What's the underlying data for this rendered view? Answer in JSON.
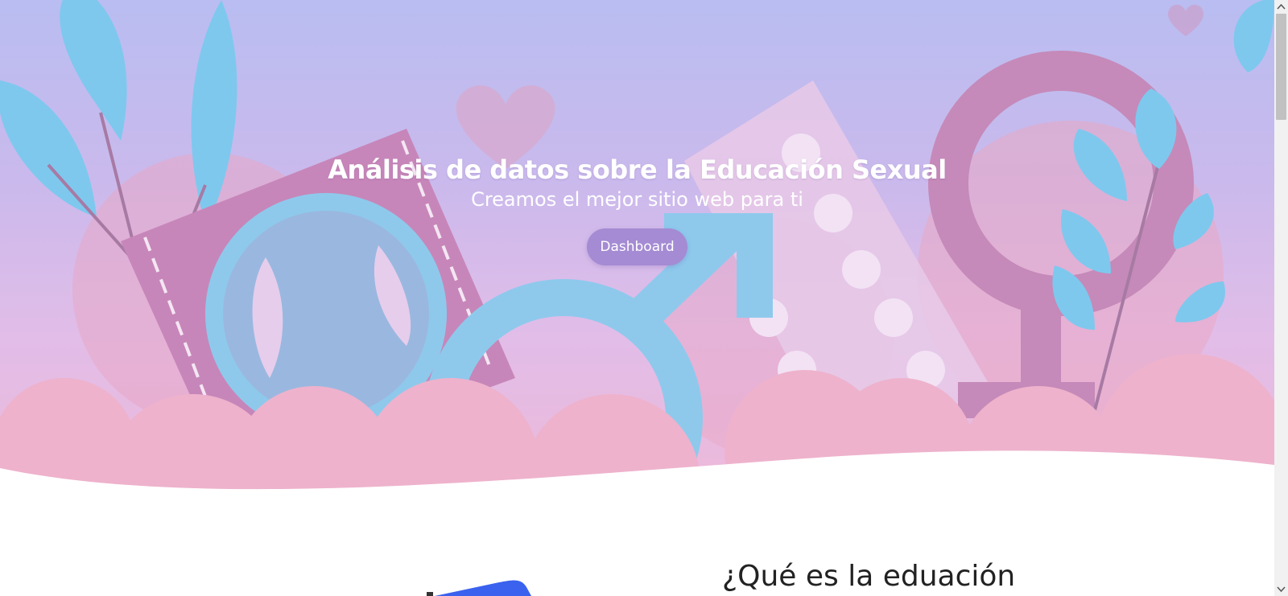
{
  "hero": {
    "title": "Análisis de datos sobre la Educación Sexual",
    "subtitle": "Creamos el mejor sitio web para ti",
    "cta_label": "Dashboard"
  },
  "section": {
    "heading": "¿Qué es la eduación"
  },
  "colors": {
    "hero_top": "#b9bdf1",
    "hero_bottom": "#efb8d8",
    "button": "#a48bd3",
    "leaf_blue": "#7ec8ee",
    "symbol_purple": "#c58ab9",
    "illustration_blue": "#3a62ef"
  },
  "icons": [
    "condom-icon",
    "male-symbol-icon",
    "female-symbol-icon",
    "pill-pack-icon",
    "heart-icon",
    "leaf-icon"
  ]
}
